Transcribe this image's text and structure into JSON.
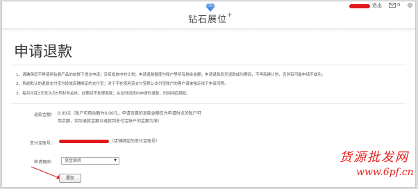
{
  "header": {
    "logo_text": "钻石展位",
    "logo_plus": "+",
    "logout": "退出",
    "mail_count": "0",
    "brand_color": "#4a90e2"
  },
  "page": {
    "title": "申请退款"
  },
  "notes": [
    "1、请确保您不再使用钻展产品的前提下提交申请；没有投放中的计划；申请退款额度为账户里所有剩余金额；申请退款后至退款成功期间，不再新建计划，否则有可能申请不成功。",
    "2、系统默认的退款支付宝为投放店铺绑定的支付宝；对于不在使用该支付宝默认支付宝账户的客户请单独走线下申请流程。",
    "3、每月月底3天至次月5号财务关帐，此期间不处理退款；在此时间段内申请的退款，时间相应顺延。"
  ],
  "form": {
    "amount_label": "退款金额：",
    "amount_line1": "0.00元（账户可用余额为0.00元，申请页面的退款金额仅为申请时点的账户可",
    "amount_line2": "用余额，实际退款金额以退款到支付宝账户的金额为准）",
    "alipay_label": "支付宝账号：",
    "alipay_suffix": "（店铺绑定的支付宝账号）",
    "reason_label": "申请理由：",
    "reason_selected": "资金周转",
    "submit_label": "提交"
  },
  "watermark": {
    "cn": "货源批发网",
    "url": "www.6pf.cn"
  }
}
